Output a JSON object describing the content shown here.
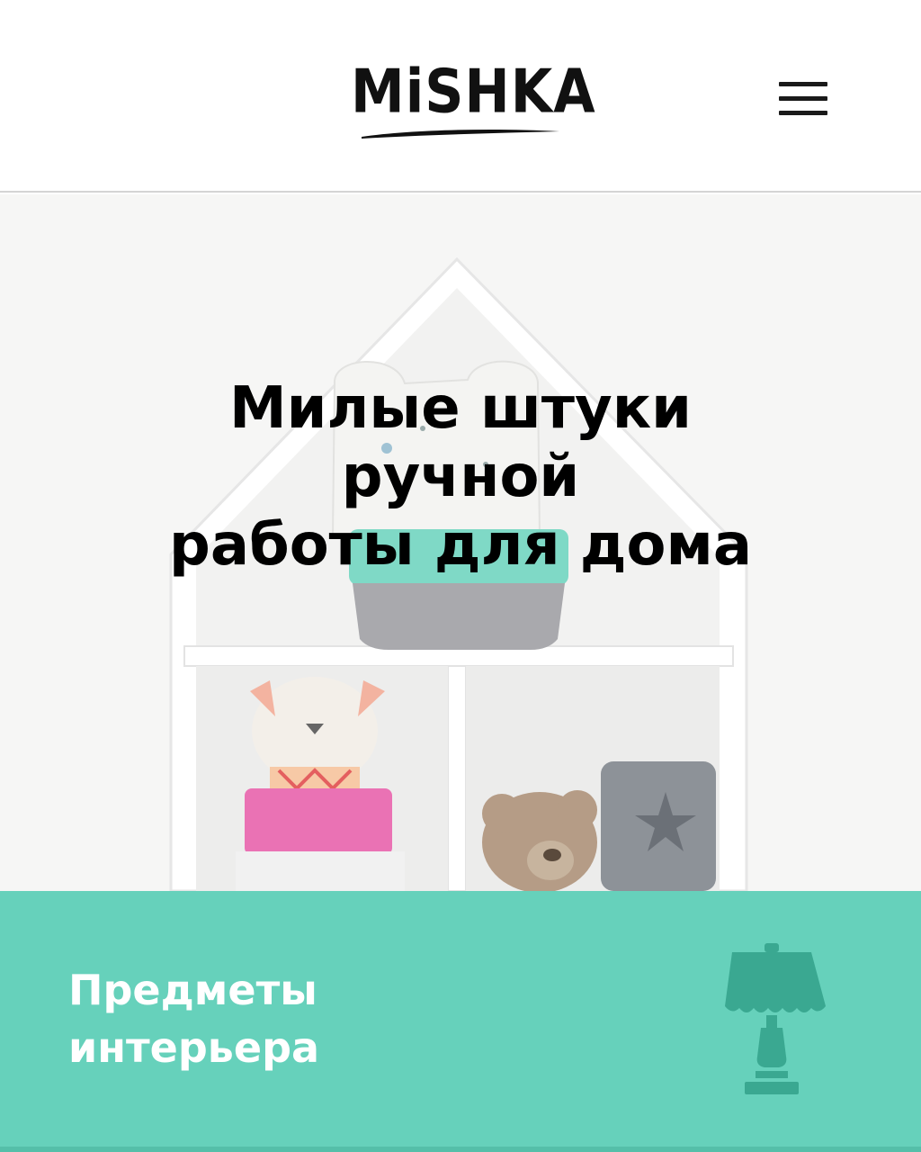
{
  "header": {
    "logo_text": "MiSHKA",
    "menu_icon": "hamburger-menu-icon"
  },
  "hero": {
    "title_lines": [
      "Милые штуки",
      "ручной",
      "работы для дома"
    ],
    "image": "house-shaped-shelf-with-handmade-toys"
  },
  "category": {
    "label_lines": [
      "Предметы",
      "интерьера"
    ],
    "icon": "lamp-icon"
  },
  "colors": {
    "accent": "#66d1bb",
    "accent_dark": "#3aa891",
    "text": "#000000",
    "header_border": "#d4d4d4"
  }
}
